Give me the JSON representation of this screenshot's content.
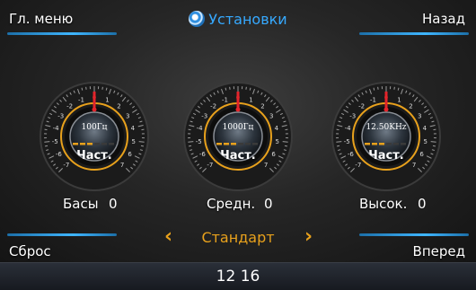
{
  "header": {
    "title": "Установки",
    "menu_label": "Гл. меню",
    "back_label": "Назад"
  },
  "colors": {
    "accent": "#e8a11c",
    "title": "#36a9ff",
    "underline": "#3fb6ff"
  },
  "dials": [
    {
      "name": "Басы",
      "value": "0",
      "freq": "100Гц",
      "button": "Част."
    },
    {
      "name": "Средн.",
      "value": "0",
      "freq": "1000Гц",
      "button": "Част."
    },
    {
      "name": "Высок.",
      "value": "0",
      "freq": "12.50KHz",
      "button": "Част."
    }
  ],
  "scale": [
    "-7",
    "-6",
    "-5",
    "-4",
    "-3",
    "-2",
    "-1",
    "0",
    "1",
    "2",
    "3",
    "4",
    "5",
    "6",
    "7"
  ],
  "footer": {
    "reset_label": "Сброс",
    "next_label": "Вперед",
    "preset": "Стандарт",
    "prev_arrow": "‹",
    "next_arrow": "›"
  },
  "status": {
    "time": "12 16"
  }
}
